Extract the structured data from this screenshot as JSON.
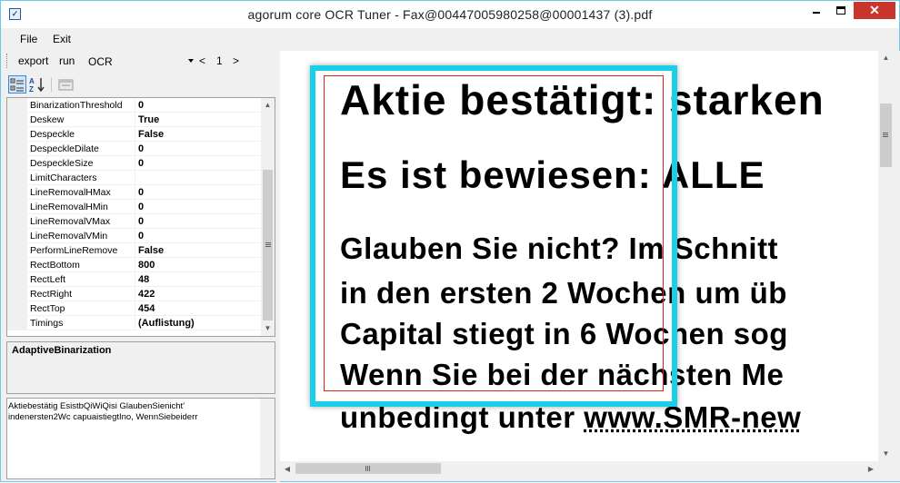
{
  "window": {
    "title": "agorum core OCR Tuner - Fax@00447005980258@00001437 (3).pdf",
    "accent_color": "#1ccfe8",
    "close_color": "#c8352b"
  },
  "menu": {
    "file": "File",
    "exit": "Exit"
  },
  "toolbar": {
    "export_label": "export",
    "run_label": "run",
    "mode_value": "OCR",
    "prev_label": "<",
    "page_number": "1",
    "next_label": ">"
  },
  "properties": [
    {
      "name": "BinarizationThreshold",
      "value": "0"
    },
    {
      "name": "Deskew",
      "value": "True"
    },
    {
      "name": "Despeckle",
      "value": "False"
    },
    {
      "name": "DespeckleDilate",
      "value": "0"
    },
    {
      "name": "DespeckleSize",
      "value": "0"
    },
    {
      "name": "LimitCharacters",
      "value": ""
    },
    {
      "name": "LineRemovalHMax",
      "value": "0"
    },
    {
      "name": "LineRemovalHMin",
      "value": "0"
    },
    {
      "name": "LineRemovalVMax",
      "value": "0"
    },
    {
      "name": "LineRemovalVMin",
      "value": "0"
    },
    {
      "name": "PerformLineRemove",
      "value": "False"
    },
    {
      "name": "RectBottom",
      "value": "800"
    },
    {
      "name": "RectLeft",
      "value": "48"
    },
    {
      "name": "RectRight",
      "value": "422"
    },
    {
      "name": "RectTop",
      "value": "454"
    },
    {
      "name": "Timings",
      "value": "(Auflistung)"
    }
  ],
  "description": {
    "title": "AdaptiveBinarization"
  },
  "ocr_result": {
    "line1": "Aktiebestätig EsistbQiWiQisi GlaubenSienicht'",
    "line2": "indenersten2Wc capuaistiegtIno, WennSiebeiderr"
  },
  "document": {
    "line1": "Aktie bestätigt: starken",
    "line2": "Es ist bewiesen: ALLE",
    "line3": "Glauben Sie nicht? Im Schnitt",
    "line4": "in den ersten 2 Wochen um üb",
    "line5": "Capital stiegt in 6 Wochen sog",
    "line6": "Wenn Sie bei der nächsten Me",
    "line7_prefix": "unbedingt unter ",
    "line7_link": "www.SMR-new"
  }
}
